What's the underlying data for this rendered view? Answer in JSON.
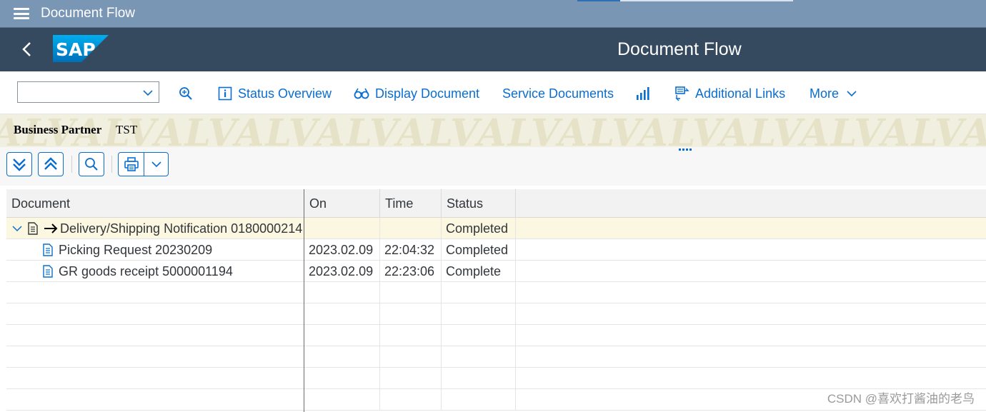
{
  "shell": {
    "title": "Document Flow",
    "progress": 0.2
  },
  "app": {
    "title": "Document Flow",
    "logo_text": "SAP",
    "brand_color": "#0a6ed1"
  },
  "toolbar": {
    "combo_value": "",
    "status_overview": "Status Overview",
    "display_document": "Display Document",
    "service_documents": "Service Documents",
    "additional_links": "Additional Links",
    "more": "More"
  },
  "banner": {
    "watermark": "ALVALVALVALVALVALVALVALVALVALVALVALVAL",
    "label": "Business Partner",
    "value": "TST"
  },
  "grid": {
    "columns": [
      "Document",
      "On",
      "Time",
      "Status"
    ],
    "rows": [
      {
        "document": "Delivery/Shipping Notification 0180000214",
        "on": "",
        "time": "",
        "status": "Completed",
        "level": 0,
        "expanded": true,
        "highlighted": true
      },
      {
        "document": "Picking Request 20230209",
        "on": "2023.02.09",
        "time": "22:04:32",
        "status": "Completed",
        "level": 1
      },
      {
        "document": "GR goods receipt 5000001194",
        "on": "2023.02.09",
        "time": "22:23:06",
        "status": "Complete",
        "level": 1
      }
    ]
  },
  "footer": {
    "watermark": "CSDN @喜欢打酱油的老鸟"
  }
}
